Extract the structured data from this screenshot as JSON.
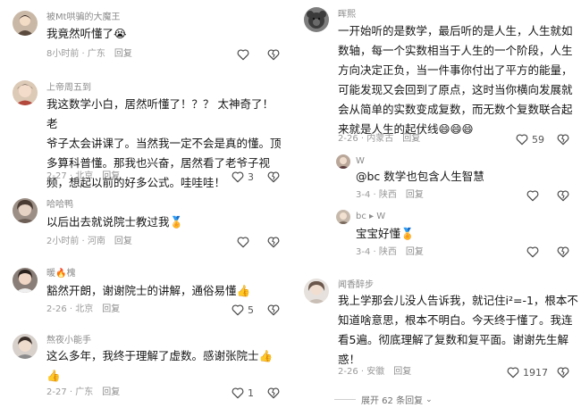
{
  "left": {
    "comments": [
      {
        "user": "被Mt哄骗的大魔王",
        "text": "我竟然听懂了😭",
        "time": "8小时前 · 广东",
        "reply": "回复",
        "likes": ""
      },
      {
        "user": "上帝周五到",
        "text_lines": [
          "我这数学小白，居然听懂了！？？ 太神奇了！ 老",
          "爷子太会讲课了。当然我一定不会是真的懂。顶",
          "多算科普懂。那我也兴奋，居然看了老爷子视",
          "频，想起以前的好多公式。哇哇哇！"
        ],
        "time": "2-27 · 北京",
        "reply": "回复",
        "likes": "3"
      },
      {
        "user": "哈哈鸭",
        "text": "以后出去就说院士教过我🏅",
        "time": "2小时前 · 河南",
        "reply": "回复",
        "likes": ""
      },
      {
        "user": "暖🔥槐",
        "text": "豁然开朗，谢谢院士的讲解，通俗易懂👍",
        "time": "2-26 · 北京",
        "reply": "回复",
        "likes": "5"
      },
      {
        "user": "熬夜小能手",
        "text_lines": [
          "这么多年，我终于理解了虚数。感谢张院士👍",
          "👍"
        ],
        "time": "2-27 · 广东",
        "reply": "回复",
        "likes": "1"
      }
    ]
  },
  "right": {
    "main": {
      "user": "晖熙",
      "text_lines": [
        "一开始听的是数学，最后听的是人生，人生就如",
        "数轴，每一个实数相当于人生的一个阶段，人生",
        "方向决定正负，当一件事你付出了平方的能量，",
        "可能发现又会回到了原点，这时当你横向发展就",
        "会从简单的实数变成复数，而无数个复数联合起",
        "来就是人生的起伏线😄😄😄"
      ],
      "time": "2-26 · 内蒙古",
      "reply": "回复",
      "likes": "59"
    },
    "sub1": {
      "user": "W",
      "text": "@bc 数学也包含人生智慧",
      "time": "3-4 · 陕西",
      "reply": "回复"
    },
    "sub2": {
      "user": "bc ▸ W",
      "text": "宝宝好懂🏅",
      "time": "3-4 · 陕西",
      "reply": "回复"
    },
    "last": {
      "user": "闻香醉步",
      "text_lines": [
        "我上学那会儿没人告诉我，就记住i²=-1，根本不",
        "知道啥意思，根本不明白。今天终于懂了。我连",
        "看5遍。彻底理解了复数和复平面。谢谢先生解",
        "惑！"
      ],
      "time": "2-26 · 安徽",
      "reply": "回复",
      "likes": "1917"
    },
    "expand": "展开 62 条回复"
  },
  "colors": {
    "text": "#161616",
    "meta": "#9a9a9a",
    "icon": "#444444"
  }
}
